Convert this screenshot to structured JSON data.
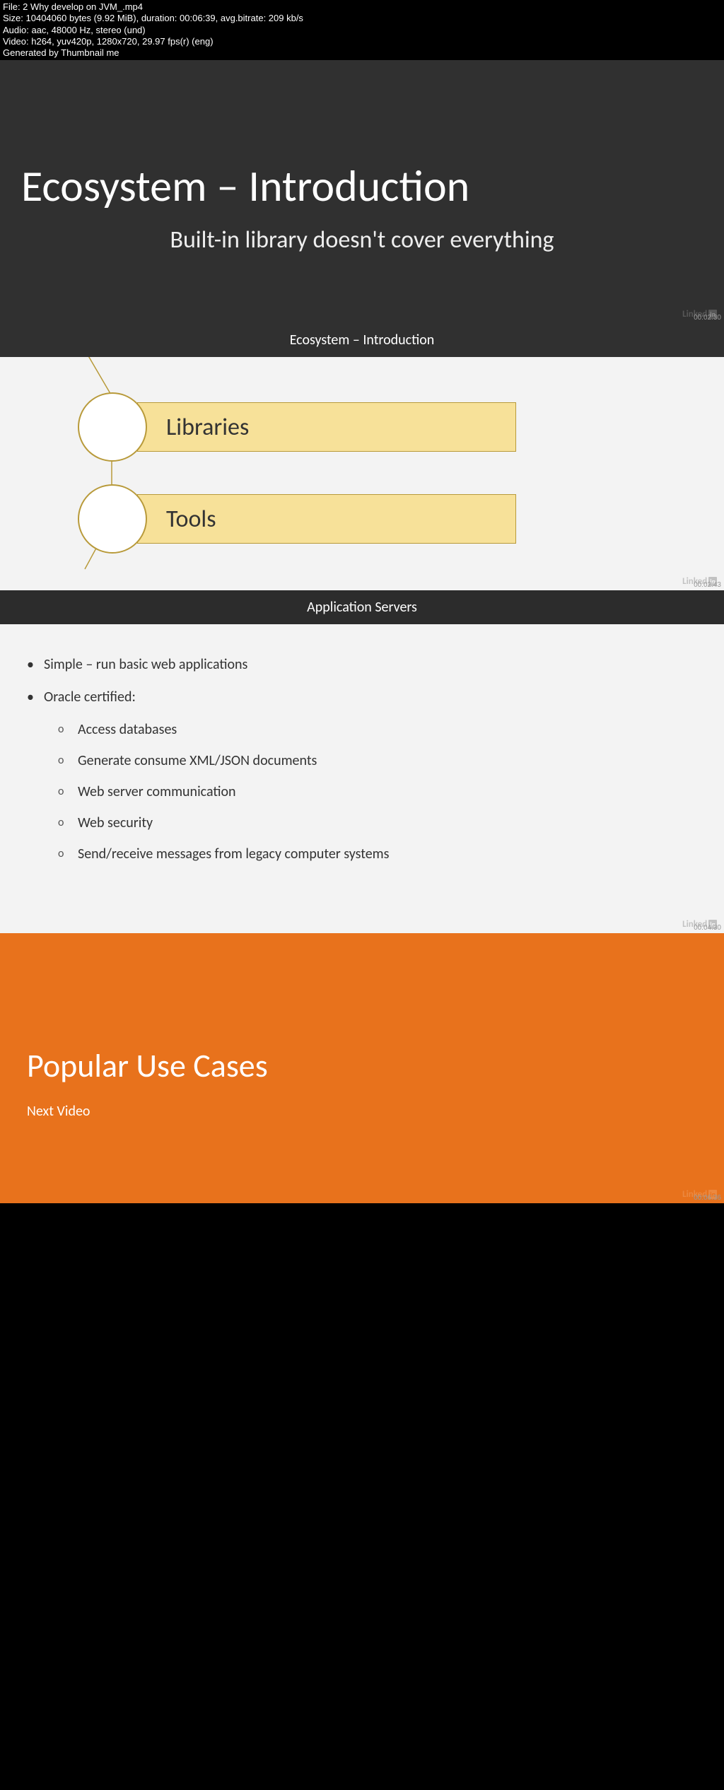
{
  "meta": {
    "line1": "File: 2 Why develop on JVM_.mp4",
    "line2": "Size: 10404060 bytes (9.92 MiB), duration: 00:06:39, avg.bitrate: 209 kb/s",
    "line3": "Audio: aac, 48000 Hz, stereo (und)",
    "line4": "Video: h264, yuv420p, 1280x720, 29.97 fps(r) (eng)",
    "line5": "Generated by Thumbnail me"
  },
  "slide1": {
    "title": "Ecosystem – Introduction",
    "subtitle": "Built-in library doesn't cover everything",
    "timestamp": "00:02:30"
  },
  "caption1": "Ecosystem – Introduction",
  "slide2": {
    "item1": "Libraries",
    "item2": "Tools",
    "timestamp": "00:02:43"
  },
  "caption2": "Application Servers",
  "slide3": {
    "b1": "Simple – run basic web applications",
    "b2": "Oracle certified:",
    "s1": "Access databases",
    "s2": "Generate consume XML/JSON documents",
    "s3": "Web server communication",
    "s4": "Web security",
    "s5": "Send/receive messages from legacy computer systems",
    "timestamp": "00:04:30"
  },
  "slide4": {
    "title": "Popular Use Cases",
    "subtitle": "Next Video",
    "timestamp": "00:06:36"
  },
  "watermark": {
    "text": "Linked",
    "box": "in"
  }
}
